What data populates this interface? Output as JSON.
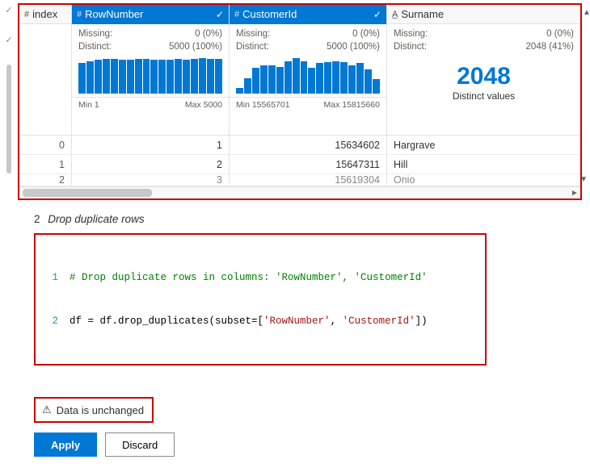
{
  "preview": {
    "columns": {
      "index": {
        "name": "index",
        "type_icon": "#"
      },
      "rowNumber": {
        "name": "RowNumber",
        "type_icon": "#",
        "selected": true,
        "missing_label": "Missing:",
        "missing_value": "0 (0%)",
        "distinct_label": "Distinct:",
        "distinct_value": "5000 (100%)",
        "min_label": "Min 1",
        "max_label": "Max 5000"
      },
      "customerId": {
        "name": "CustomerId",
        "type_icon": "#",
        "selected": true,
        "missing_label": "Missing:",
        "missing_value": "0 (0%)",
        "distinct_label": "Distinct:",
        "distinct_value": "5000 (100%)",
        "min_label": "Min 15565701",
        "max_label": "Max 15815660"
      },
      "surname": {
        "name": "Surname",
        "type_icon": "A̲",
        "missing_label": "Missing:",
        "missing_value": "0 (0%)",
        "distinct_label": "Distinct:",
        "distinct_value": "2048 (41%)",
        "big_value": "2048",
        "big_label": "Distinct values"
      }
    },
    "rows": [
      {
        "index": "0",
        "rowNumber": "1",
        "customerId": "15634602",
        "surname": "Hargrave"
      },
      {
        "index": "1",
        "rowNumber": "2",
        "customerId": "15647311",
        "surname": "Hill"
      },
      {
        "index": "2",
        "rowNumber": "3",
        "customerId": "15619304",
        "surname": "Onio"
      }
    ]
  },
  "chart_data": [
    {
      "type": "bar",
      "column": "RowNumber",
      "values": [
        43,
        46,
        48,
        49,
        49,
        48,
        48,
        49,
        49,
        48,
        48,
        48,
        49,
        48,
        49,
        50,
        49,
        49
      ],
      "xlabel": "",
      "ylabel": "",
      "min": 1,
      "max": 5000
    },
    {
      "type": "bar",
      "column": "CustomerId",
      "values": [
        8,
        22,
        36,
        40,
        40,
        38,
        45,
        50,
        46,
        36,
        43,
        44,
        46,
        44,
        40,
        43,
        34,
        20
      ],
      "xlabel": "",
      "ylabel": "",
      "min": 15565701,
      "max": 15815660
    }
  ],
  "step": {
    "number": "2",
    "title": "Drop duplicate rows"
  },
  "code": {
    "line1_num": "1",
    "line1_comment": "# Drop duplicate rows in columns: 'RowNumber', 'CustomerId'",
    "line2_num": "2",
    "line2_a": "df = df.drop_duplicates(subset=[",
    "line2_s1": "'RowNumber'",
    "line2_sep": ", ",
    "line2_s2": "'CustomerId'",
    "line2_b": "])"
  },
  "status": {
    "text": "Data is unchanged"
  },
  "buttons": {
    "apply": "Apply",
    "discard": "Discard"
  }
}
